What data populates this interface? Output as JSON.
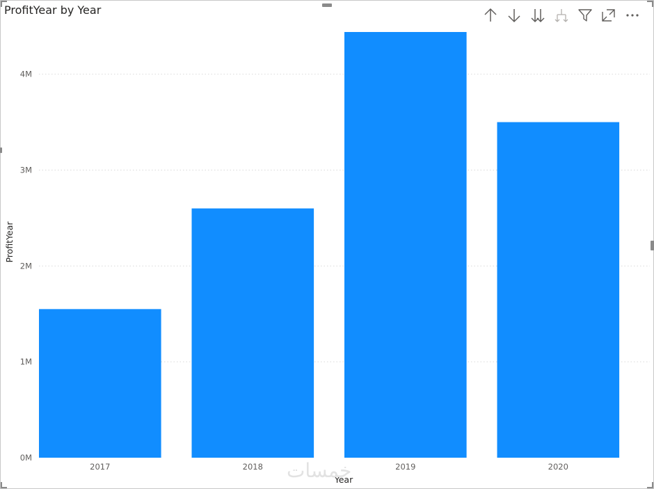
{
  "header": {
    "title": "ProfitYear by Year"
  },
  "toolbar": {
    "icons": [
      "drill-up-icon",
      "drill-down-icon",
      "expand-next-level-icon",
      "expand-hierarchy-icon",
      "filter-icon",
      "focus-mode-icon",
      "more-options-icon"
    ]
  },
  "colors": {
    "bar": "#118dff",
    "grid": "#d9d9d9",
    "axis_text": "#605e5c",
    "title": "#252423",
    "icon": "#605e5c",
    "icon_disabled": "#b3b0ad"
  },
  "chart_data": {
    "type": "bar",
    "title": "ProfitYear by Year",
    "xlabel": "Year",
    "ylabel": "ProfitYear",
    "categories": [
      "2017",
      "2018",
      "2019",
      "2020"
    ],
    "values": [
      1550000,
      2600000,
      4440000,
      3500000
    ],
    "ylim": [
      0,
      4440000
    ],
    "yticks": [
      0,
      1000000,
      2000000,
      3000000,
      4000000
    ],
    "ytick_labels": [
      "0M",
      "1M",
      "2M",
      "3M",
      "4M"
    ],
    "grid": true,
    "legend": "none"
  },
  "watermark": {
    "text": "خمسات"
  }
}
